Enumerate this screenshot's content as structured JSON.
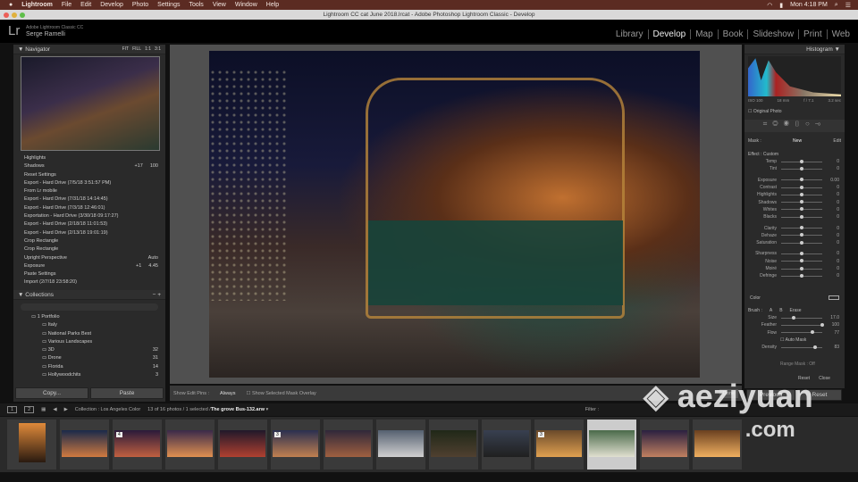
{
  "menubar": {
    "apple": "",
    "app": "Lightroom",
    "items": [
      "File",
      "Edit",
      "Develop",
      "Photo",
      "Settings",
      "Tools",
      "View",
      "Window",
      "Help"
    ],
    "clock": "Mon 4:18 PM"
  },
  "window_title": "Lightroom CC cat June 2018.lrcat - Adobe Photoshop Lightroom Classic - Develop",
  "identity": {
    "logo": "Lr",
    "product": "Adobe Lightroom Classic CC",
    "user": "Serge Ramelli"
  },
  "modules": [
    {
      "label": "Library"
    },
    {
      "label": "Develop",
      "active": true
    },
    {
      "label": "Map"
    },
    {
      "label": "Book"
    },
    {
      "label": "Slideshow"
    },
    {
      "label": "Print"
    },
    {
      "label": "Web"
    }
  ],
  "navigator": {
    "title": "Navigator",
    "zoom": [
      "FIT",
      "FILL",
      "1:1",
      "3:1"
    ]
  },
  "history": [
    {
      "label": "Highlights",
      "a": "",
      "b": ""
    },
    {
      "label": "Shadows",
      "a": "+17",
      "b": "100"
    },
    {
      "label": "Reset Settings",
      "a": "",
      "b": ""
    },
    {
      "label": "Export - Hard Drive (7/5/18 3:51:57 PM)",
      "a": "",
      "b": ""
    },
    {
      "label": "From Lr mobile",
      "a": "",
      "b": ""
    },
    {
      "label": "Export - Hard Drive (7/31/18 14:14:45)",
      "a": "",
      "b": ""
    },
    {
      "label": "Export - Hard Drive (7/3/18 12:46:01)",
      "a": "",
      "b": ""
    },
    {
      "label": "Exportation - Hard Drive (3/30/18 09:17:27)",
      "a": "",
      "b": ""
    },
    {
      "label": "Export - Hard Drive (2/18/18 11:01:53)",
      "a": "",
      "b": ""
    },
    {
      "label": "Export - Hard Drive (2/13/18 19:01:19)",
      "a": "",
      "b": ""
    },
    {
      "label": "Crop Rectangle",
      "a": "",
      "b": ""
    },
    {
      "label": "Crop Rectangle",
      "a": "",
      "b": ""
    },
    {
      "label": "Upright Perspective",
      "a": "",
      "b": "Auto"
    },
    {
      "label": "Exposure",
      "a": "+1",
      "b": "4.45"
    },
    {
      "label": "Paste Settings",
      "a": "",
      "b": ""
    },
    {
      "label": "Import (2/7/18 23:58:20)",
      "a": "",
      "b": ""
    }
  ],
  "collections": {
    "title": "Collections",
    "items": [
      {
        "label": "1 Portfolio",
        "indent": 1,
        "count": ""
      },
      {
        "label": "Italy",
        "indent": 2,
        "count": ""
      },
      {
        "label": "National Parks Best",
        "indent": 2,
        "count": ""
      },
      {
        "label": "Various Landscapes",
        "indent": 2,
        "count": ""
      },
      {
        "label": "3D",
        "indent": 2,
        "count": "32"
      },
      {
        "label": "Drone",
        "indent": 2,
        "count": "31"
      },
      {
        "label": "Florida",
        "indent": 2,
        "count": "14"
      },
      {
        "label": "Hollywoodchits",
        "indent": 2,
        "count": "3"
      }
    ]
  },
  "copy_label": "Copy...",
  "paste_label": "Paste",
  "toolbar": {
    "show_edit_pins_label": "Show Edit Pins :",
    "show_edit_pins_value": "Always",
    "overlay_label": "Show Selected Mask Overlay"
  },
  "histogram": {
    "title": "Histogram",
    "iso": "ISO 100",
    "focal": "18 mm",
    "aperture": "f / 7.1",
    "shutter": "3.2 sec",
    "original_photo": "Original Photo"
  },
  "mask": {
    "label": "Mask :",
    "new": "New",
    "edit": "Edit"
  },
  "effect": {
    "label": "Effect :",
    "value": "Custom"
  },
  "sliders": [
    {
      "label": "Temp",
      "value": "0",
      "pos": 0.5
    },
    {
      "label": "Tint",
      "value": "0",
      "pos": 0.5
    },
    {
      "label": "",
      "value": "",
      "pos": null
    },
    {
      "label": "Exposure",
      "value": "0.00",
      "pos": 0.5
    },
    {
      "label": "Contrast",
      "value": "0",
      "pos": 0.5
    },
    {
      "label": "Highlights",
      "value": "0",
      "pos": 0.5
    },
    {
      "label": "Shadows",
      "value": "0",
      "pos": 0.5
    },
    {
      "label": "Whites",
      "value": "0",
      "pos": 0.5
    },
    {
      "label": "Blacks",
      "value": "0",
      "pos": 0.5
    },
    {
      "label": "",
      "value": "",
      "pos": null
    },
    {
      "label": "Clarity",
      "value": "0",
      "pos": 0.5
    },
    {
      "label": "Dehaze",
      "value": "0",
      "pos": 0.5
    },
    {
      "label": "Saturation",
      "value": "0",
      "pos": 0.5
    },
    {
      "label": "",
      "value": "",
      "pos": null
    },
    {
      "label": "Sharpness",
      "value": "0",
      "pos": 0.5
    },
    {
      "label": "Noise",
      "value": "0",
      "pos": 0.5
    },
    {
      "label": "Moiré",
      "value": "0",
      "pos": 0.5
    },
    {
      "label": "Defringe",
      "value": "0",
      "pos": 0.5
    }
  ],
  "color_label": "Color",
  "brush": {
    "label": "Brush :",
    "a": "A",
    "b": "B",
    "erase": "Erase",
    "sliders": [
      {
        "label": "Size",
        "value": "17.0",
        "pos": 0.3
      },
      {
        "label": "Feather",
        "value": "100",
        "pos": 1.0
      },
      {
        "label": "Flow",
        "value": "77",
        "pos": 0.77
      }
    ],
    "auto_mask": "Auto Mask",
    "density": {
      "label": "Density",
      "value": "83",
      "pos": 0.83
    }
  },
  "range_mask": "Range Mask : Off",
  "reset_label": "Reset",
  "close_label": "Close",
  "previous_label": "Previous",
  "reset_button": "Reset",
  "filmbar": {
    "pages": [
      "1",
      "2"
    ],
    "collection": "Collection : Los Angeles Color",
    "count": "13 of 16 photos / 1 selected /",
    "filename": "The grove Bus-132.arw",
    "filter": "Filter :"
  },
  "film_badges": [
    "",
    "4",
    "",
    "",
    "3",
    "",
    "",
    "",
    "",
    "3",
    "",
    "",
    ""
  ],
  "watermark": {
    "name": "aeziyuan",
    ".com": ".com"
  },
  "colors": {
    "menubar": "#5b2b22",
    "panel": "#2a2a2a",
    "canvas": "#505050"
  }
}
